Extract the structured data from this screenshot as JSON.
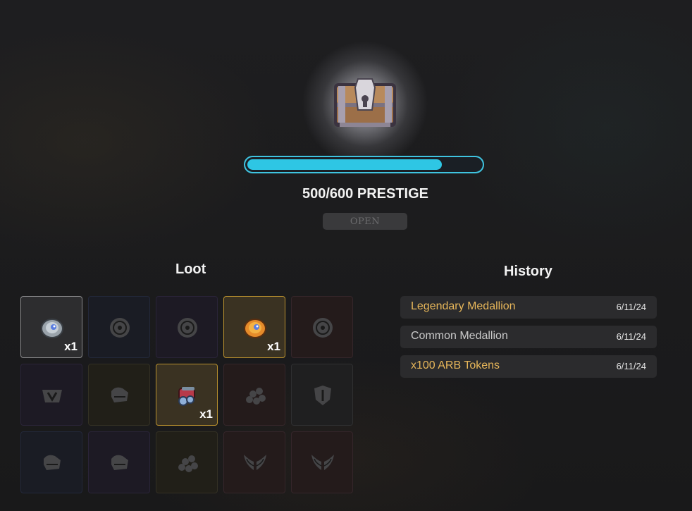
{
  "chest": {
    "progress_label": "500/600 PRESTIGE",
    "progress_current": 500,
    "progress_max": 600,
    "open_label": "OPEN",
    "accent_color": "#2ec6e4"
  },
  "loot": {
    "title": "Loot",
    "items": [
      {
        "icon": "silver-medallion-icon",
        "qty": "x1",
        "state": "owned",
        "rarity": "common"
      },
      {
        "icon": "medallion-icon",
        "qty": "",
        "state": "locked",
        "rarity": "rare"
      },
      {
        "icon": "medallion-icon",
        "qty": "",
        "state": "locked",
        "rarity": "epic"
      },
      {
        "icon": "gold-medallion-icon",
        "qty": "x1",
        "state": "owned",
        "rarity": "legendary"
      },
      {
        "icon": "medallion-icon",
        "qty": "",
        "state": "locked",
        "rarity": "mythic"
      },
      {
        "icon": "emblem-icon",
        "qty": "",
        "state": "locked",
        "rarity": "epic"
      },
      {
        "icon": "gauntlet-icon",
        "qty": "",
        "state": "locked",
        "rarity": "legendary"
      },
      {
        "icon": "token-scroll-icon",
        "qty": "x1",
        "state": "owned",
        "rarity": "legendary"
      },
      {
        "icon": "coin-pile-icon",
        "qty": "",
        "state": "locked",
        "rarity": "mythic"
      },
      {
        "icon": "shield-emblem-icon",
        "qty": "",
        "state": "locked",
        "rarity": "common"
      },
      {
        "icon": "gauntlet-icon",
        "qty": "",
        "state": "locked",
        "rarity": "rare"
      },
      {
        "icon": "gauntlet-icon",
        "qty": "",
        "state": "locked",
        "rarity": "epic"
      },
      {
        "icon": "coin-pile-icon",
        "qty": "",
        "state": "locked",
        "rarity": "legendary"
      },
      {
        "icon": "wings-icon",
        "qty": "",
        "state": "locked",
        "rarity": "mythic"
      },
      {
        "icon": "wings-icon",
        "qty": "",
        "state": "locked",
        "rarity": "mythic"
      }
    ]
  },
  "history": {
    "title": "History",
    "rows": [
      {
        "name": "Legendary Medallion",
        "date": "6/11/24",
        "color": "#e8b75a"
      },
      {
        "name": "Common Medallion",
        "date": "6/11/24",
        "color": "#c9c9c9"
      },
      {
        "name": "x100 ARB Tokens",
        "date": "6/11/24",
        "color": "#e8b75a"
      }
    ]
  }
}
